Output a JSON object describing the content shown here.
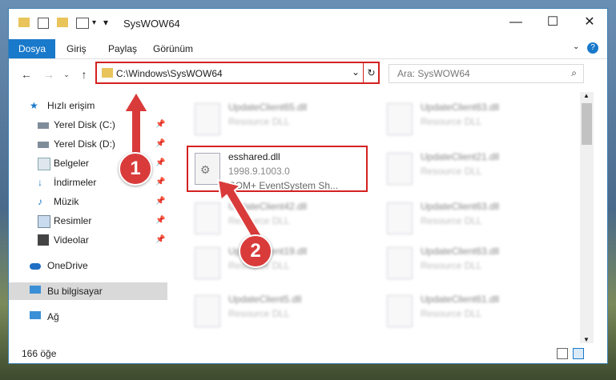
{
  "window": {
    "title": "SysWOW64"
  },
  "ribbon": {
    "tabs": [
      "Dosya",
      "Giriş",
      "Paylaş",
      "Görünüm"
    ]
  },
  "address": {
    "path": "C:\\Windows\\SysWOW64"
  },
  "search": {
    "placeholder": "Ara: SysWOW64"
  },
  "sidebar": {
    "items": [
      {
        "label": "Hızlı erişim",
        "icon": "star-icon"
      },
      {
        "label": "Yerel Disk (C:)",
        "icon": "drive-icon"
      },
      {
        "label": "Yerel Disk (D:)",
        "icon": "drive-icon"
      },
      {
        "label": "Belgeler",
        "icon": "documents-icon"
      },
      {
        "label": "İndirmeler",
        "icon": "download-icon"
      },
      {
        "label": "Müzik",
        "icon": "music-icon"
      },
      {
        "label": "Resimler",
        "icon": "pictures-icon"
      },
      {
        "label": "Videolar",
        "icon": "video-icon"
      },
      {
        "label": "OneDrive",
        "icon": "cloud-icon"
      },
      {
        "label": "Bu bilgisayar",
        "icon": "computer-icon"
      },
      {
        "label": "Ağ",
        "icon": "network-icon"
      }
    ]
  },
  "files": {
    "selected": {
      "name": "esshared.dll",
      "version": "1998.9.1003.0",
      "description": "COM+ EventSystem Sh..."
    },
    "others": [
      {
        "name": "UpdateClient65.dll",
        "type": "Resource DLL"
      },
      {
        "name": "UpdateClient63.dll",
        "type": "Resource DLL"
      },
      {
        "name": "UpdateClient21.dll",
        "type": "Resource DLL"
      },
      {
        "name": "UpdateClient42.dll",
        "type": "Resource DLL"
      },
      {
        "name": "UpdateClient63.dll",
        "type": "Resource DLL"
      },
      {
        "name": "UpdateClient19.dll",
        "type": "Resource DLL"
      },
      {
        "name": "UpdateClient63.dll",
        "type": "Resource DLL"
      },
      {
        "name": "UpdateClient5.dll",
        "type": "Resource DLL"
      },
      {
        "name": "UpdateClient61.dll",
        "type": "Resource DLL"
      }
    ]
  },
  "status": {
    "count": "166 öğe"
  },
  "callouts": [
    "1",
    "2"
  ],
  "colors": {
    "accent": "#1979ca",
    "highlight": "#d42121"
  }
}
